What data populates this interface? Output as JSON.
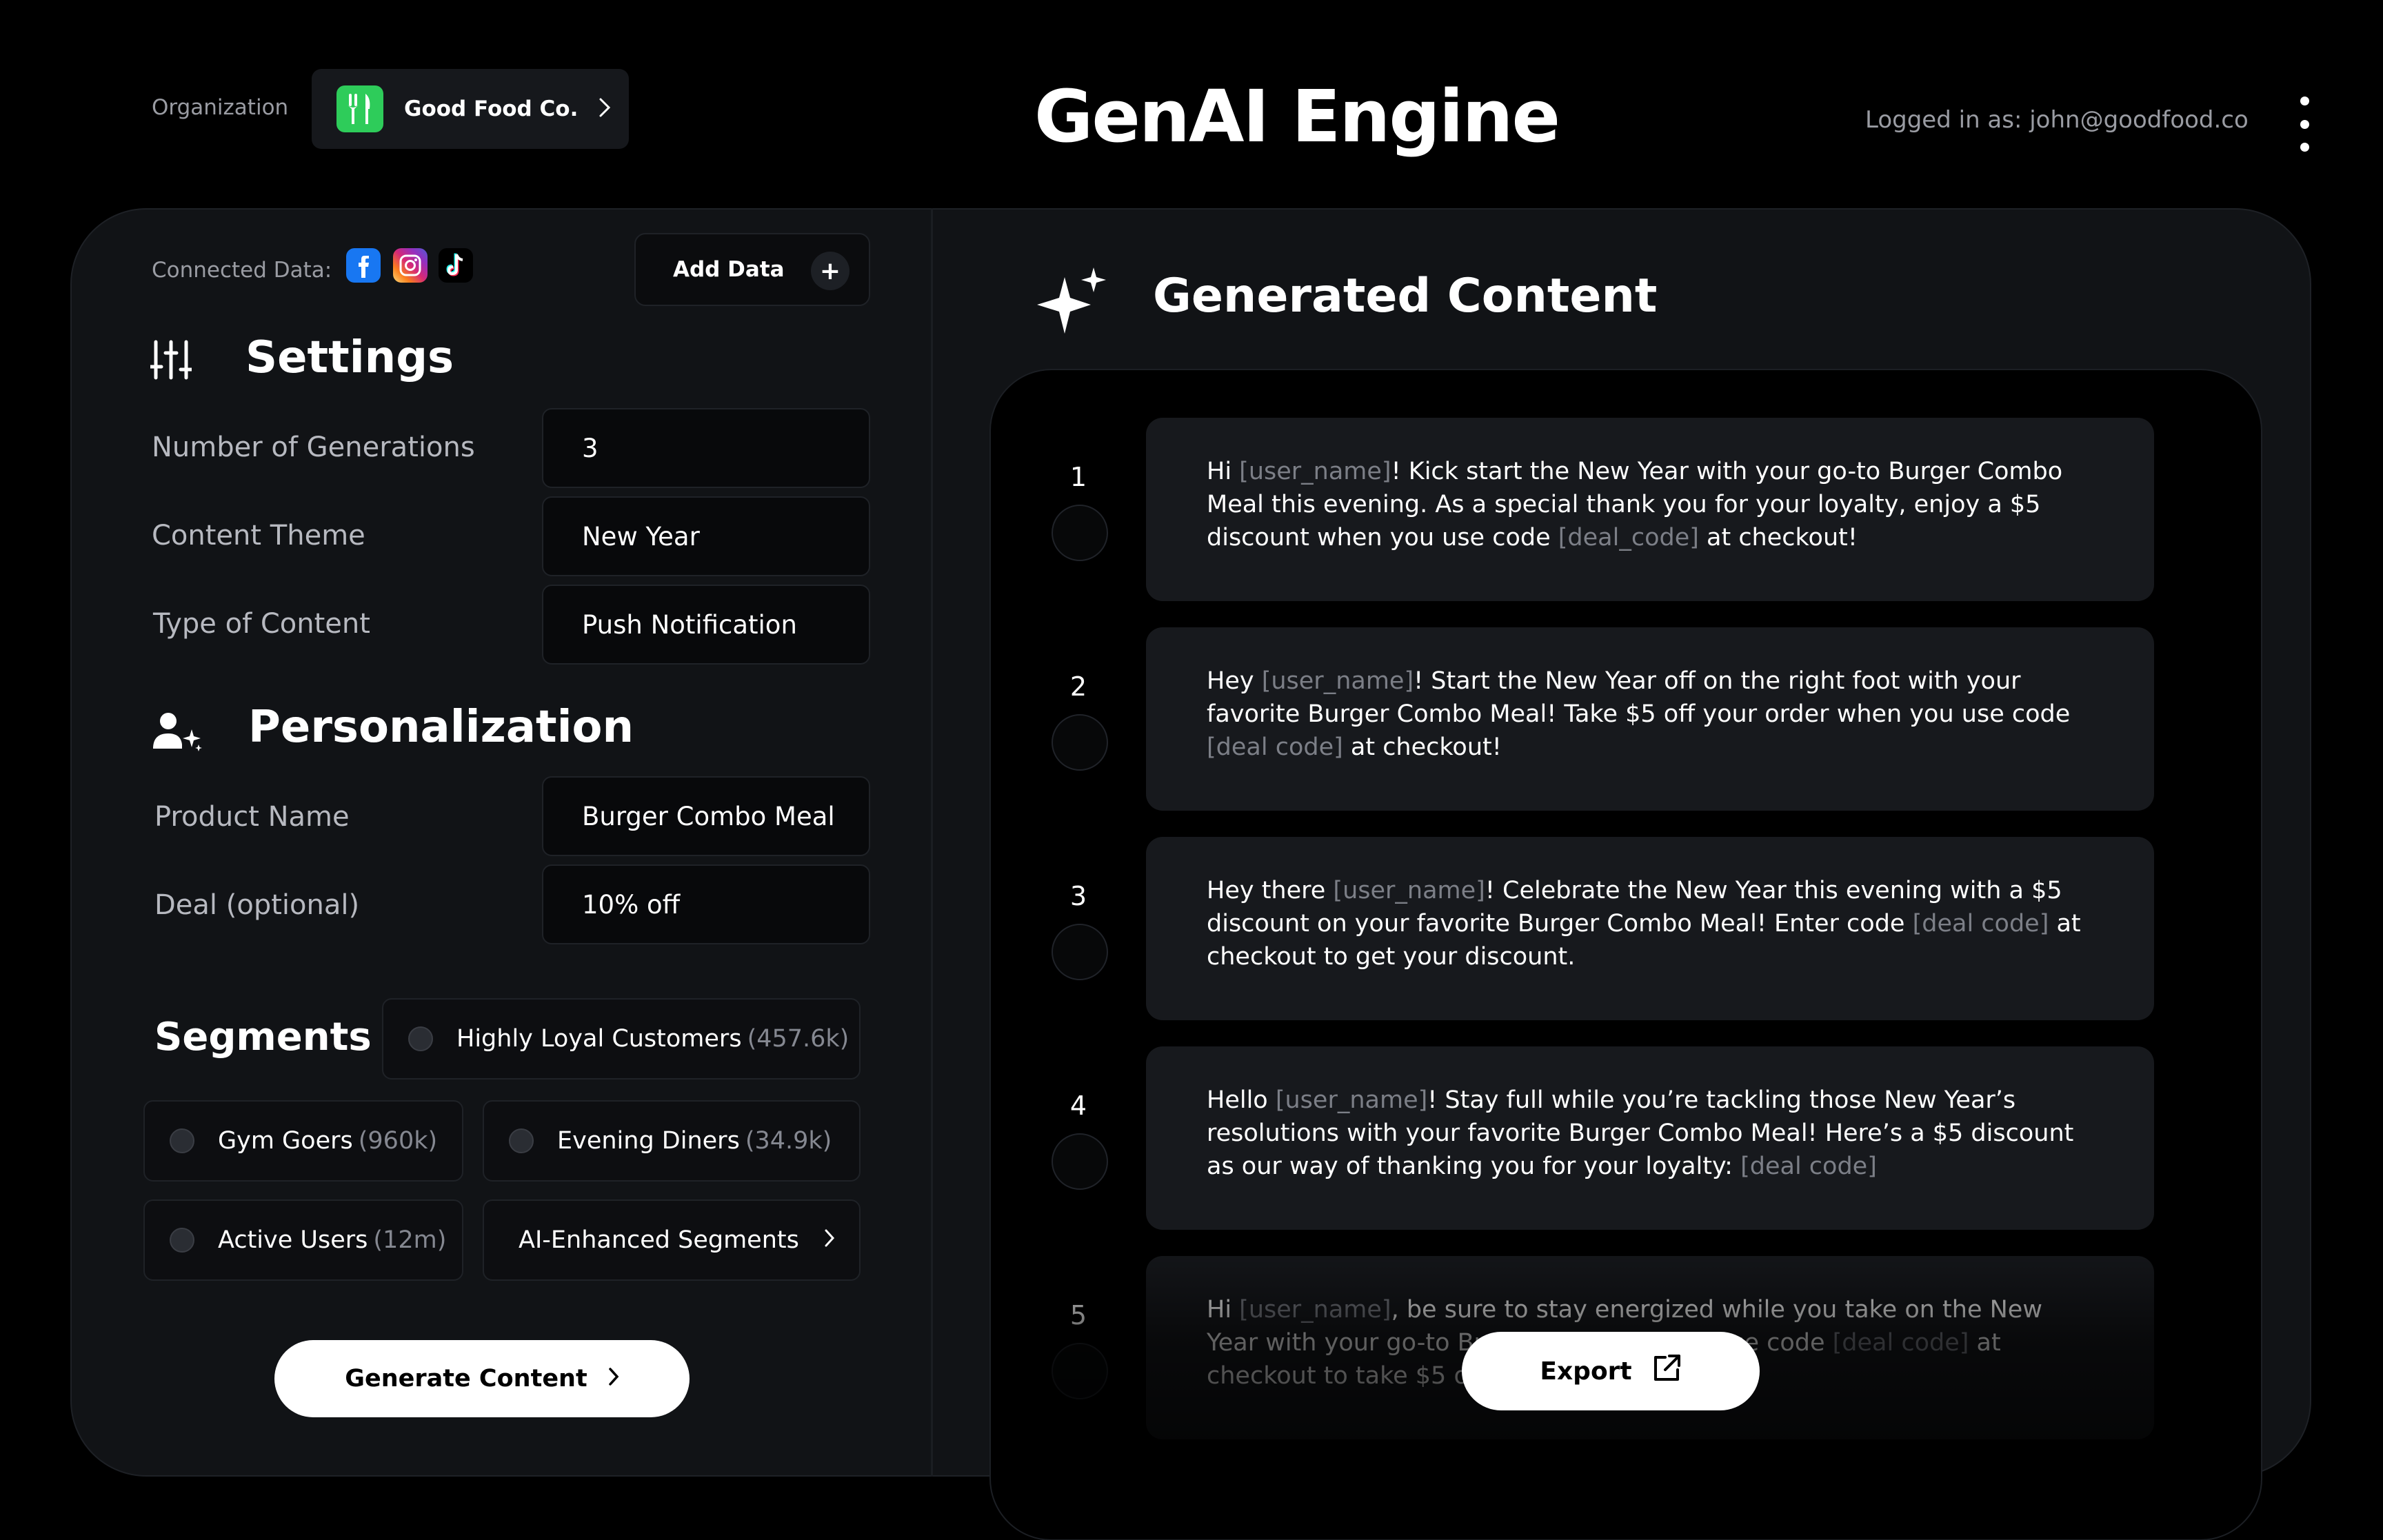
{
  "header": {
    "org_label": "Organization",
    "org_name": "Good Food Co.",
    "app_title": "GenAI Engine",
    "logged_in": "Logged in as: john@goodfood.co"
  },
  "connected": {
    "label": "Connected Data:",
    "sources": [
      "facebook-icon",
      "instagram-icon",
      "tiktok-icon"
    ],
    "add_data_label": "Add Data"
  },
  "settings": {
    "title": "Settings",
    "fields": [
      {
        "label": "Number of Generations",
        "value": "3"
      },
      {
        "label": "Content Theme",
        "value": "New Year"
      },
      {
        "label": "Type of Content",
        "value": "Push Notification"
      }
    ]
  },
  "personalization": {
    "title": "Personalization",
    "fields": [
      {
        "label": "Product Name",
        "value": "Burger Combo Meal"
      },
      {
        "label": "Deal (optional)",
        "value": "10% off"
      }
    ]
  },
  "segments": {
    "title": "Segments",
    "items": [
      {
        "name": "Highly Loyal Customers",
        "count": "(457.6k)"
      },
      {
        "name": "Gym Goers",
        "count": "(960k)"
      },
      {
        "name": "Evening Diners",
        "count": "(34.9k)"
      },
      {
        "name": "Active Users",
        "count": "(12m)"
      }
    ],
    "ai_enhanced_label": "AI-Enhanced Segments"
  },
  "generate_label": "Generate Content",
  "generated": {
    "title": "Generated Content",
    "export_label": "Export",
    "items": [
      {
        "num": "1",
        "parts": [
          {
            "t": "Hi "
          },
          {
            "t": "[user_name]",
            "ph": true
          },
          {
            "t": "! Kick start the New Year with your go-to Burger Combo Meal this evening. As a special thank you for your loyalty, enjoy a $5 discount when you use code "
          },
          {
            "t": "[deal_code]",
            "ph": true
          },
          {
            "t": " at checkout!"
          }
        ]
      },
      {
        "num": "2",
        "parts": [
          {
            "t": "Hey "
          },
          {
            "t": "[user_name]",
            "ph": true
          },
          {
            "t": "! Start the New Year off on the right foot with your favorite Burger Combo Meal! Take $5 off your order when you use code "
          },
          {
            "t": "[deal code]",
            "ph": true
          },
          {
            "t": " at checkout!"
          }
        ]
      },
      {
        "num": "3",
        "parts": [
          {
            "t": "Hey there "
          },
          {
            "t": "[user_name]",
            "ph": true
          },
          {
            "t": "! Celebrate the New Year this evening with a $5 discount on your favorite Burger Combo Meal! Enter code "
          },
          {
            "t": "[deal code]",
            "ph": true
          },
          {
            "t": " at checkout to get your discount."
          }
        ]
      },
      {
        "num": "4",
        "parts": [
          {
            "t": "Hello "
          },
          {
            "t": "[user_name]",
            "ph": true
          },
          {
            "t": "! Stay full while you’re tackling those New Year’s resolutions with your favorite Burger Combo Meal! Here’s a $5 discount as our way of thanking you for your loyalty: "
          },
          {
            "t": "[deal code]",
            "ph": true
          }
        ]
      },
      {
        "num": "5",
        "parts": [
          {
            "t": "Hi "
          },
          {
            "t": "[user_name]",
            "ph": true
          },
          {
            "t": ", be sure to stay energized while you take on the New Year with your go-to Burger Combo Meal! Use code "
          },
          {
            "t": "[deal code]",
            "ph": true
          },
          {
            "t": " at checkout to take $5 off your next order!"
          }
        ]
      }
    ]
  },
  "colors": {
    "background": "#000000",
    "panel": "#111316",
    "card": "#17191d",
    "accent_green": "#2ecc5a",
    "placeholder_text": "#7c7f87"
  }
}
